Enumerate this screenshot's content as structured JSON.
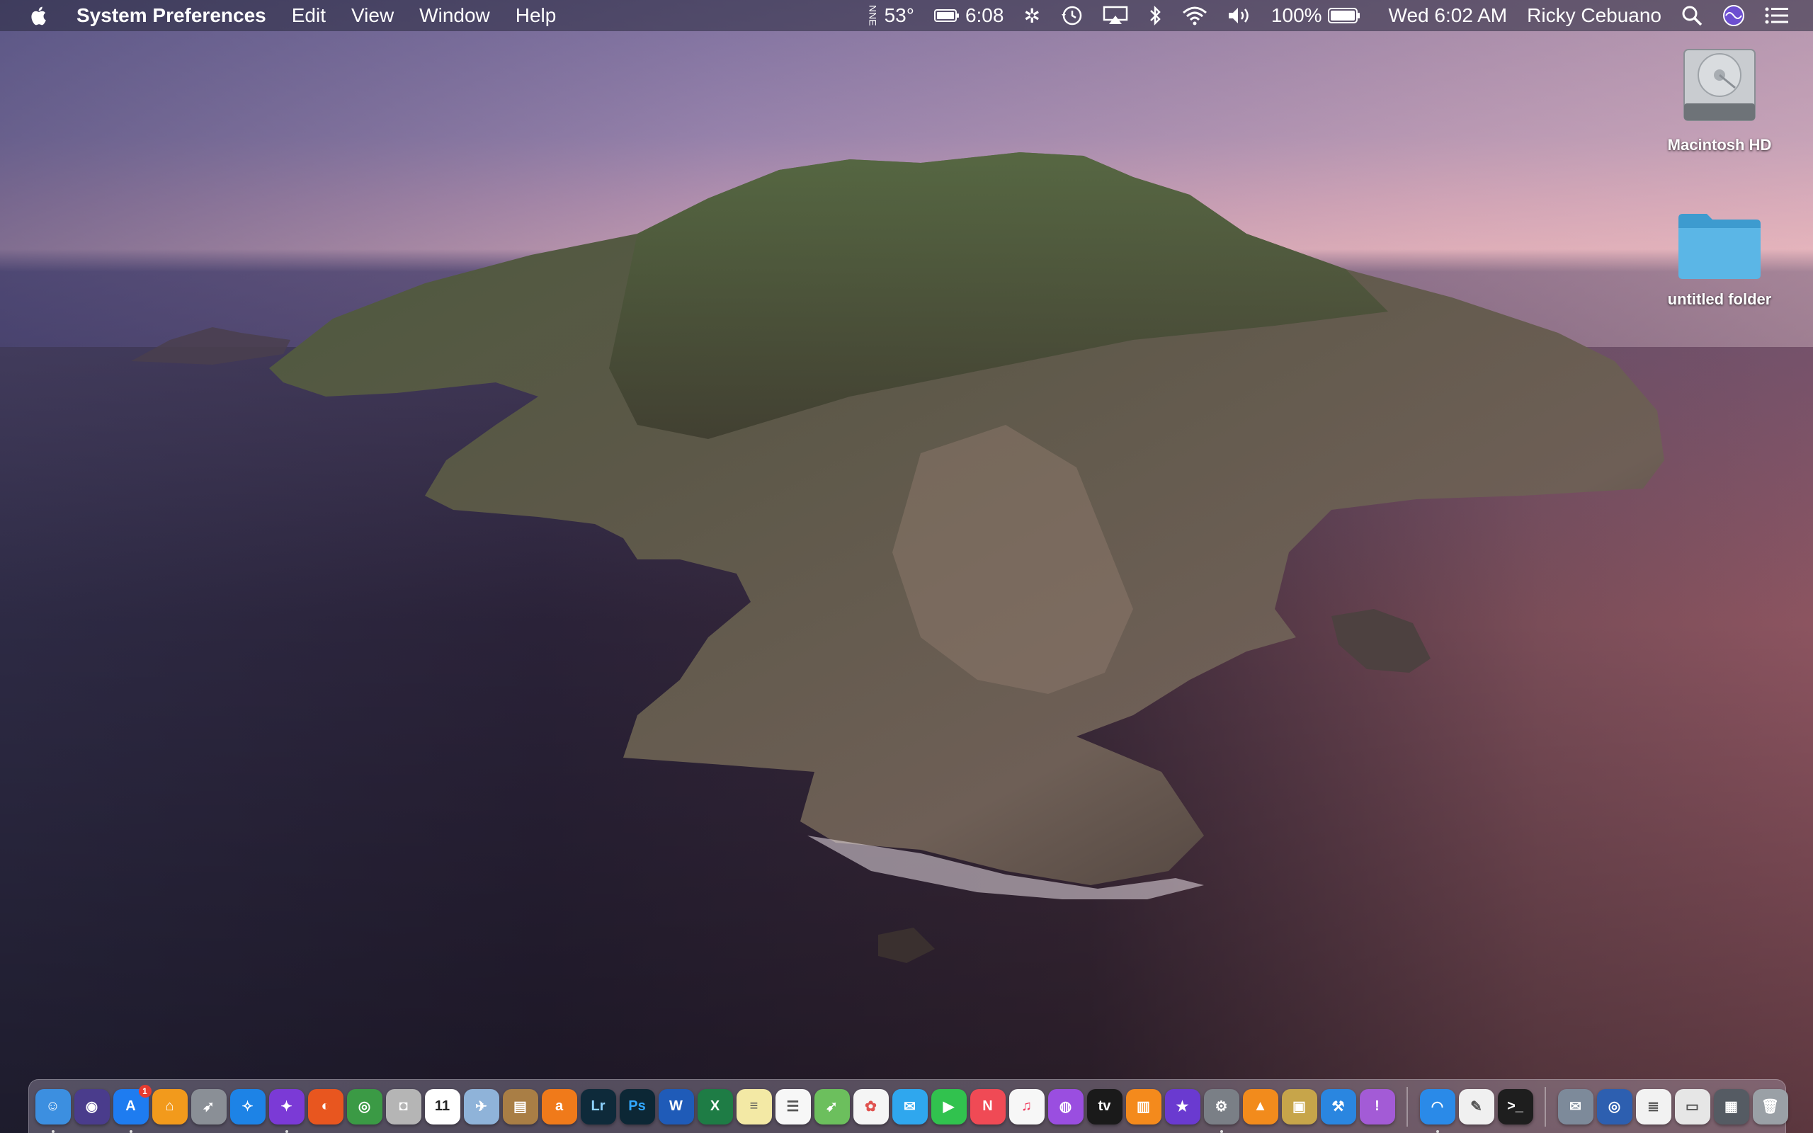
{
  "menubar": {
    "app_name": "System Preferences",
    "menus": [
      "Edit",
      "View",
      "Window",
      "Help"
    ],
    "status": {
      "weather": "53°",
      "battery_time": "6:08",
      "battery_percent": "100%",
      "datetime": "Wed 6:02 AM",
      "user": "Ricky Cebuano"
    }
  },
  "desktop": {
    "icons": [
      {
        "label": "Macintosh HD",
        "icon": "hard-drive-icon"
      },
      {
        "label": "untitled folder",
        "icon": "folder-icon"
      }
    ]
  },
  "dock": {
    "apps": [
      {
        "name": "Finder",
        "color": "#3c8fe0",
        "glyph": "☺",
        "running": true
      },
      {
        "name": "Siri",
        "color": "#4a3c8c",
        "glyph": "◉"
      },
      {
        "name": "App Store",
        "color": "#1e7cf0",
        "glyph": "A",
        "badge": "1",
        "running": true
      },
      {
        "name": "Home",
        "color": "#f29a1c",
        "glyph": "⌂"
      },
      {
        "name": "Launchpad",
        "color": "#8a8f96",
        "glyph": "➶"
      },
      {
        "name": "Safari",
        "color": "#1d83e6",
        "glyph": "✧"
      },
      {
        "name": "Compass",
        "color": "#7b3ad6",
        "glyph": "✦",
        "running": true
      },
      {
        "name": "Firefox",
        "color": "#e8561f",
        "glyph": "◐"
      },
      {
        "name": "Chrome",
        "color": "#3b9a45",
        "glyph": "◎"
      },
      {
        "name": "Screenshot",
        "color": "#b5b5b5",
        "glyph": "◘"
      },
      {
        "name": "Calendar",
        "color": "#ffffff",
        "glyph": "11",
        "text_color": "#222"
      },
      {
        "name": "Preview",
        "color": "#8fb3d9",
        "glyph": "✈"
      },
      {
        "name": "Archive Utility",
        "color": "#a97e45",
        "glyph": "▤"
      },
      {
        "name": "Avast",
        "color": "#f07a1a",
        "glyph": "a"
      },
      {
        "name": "Lightroom",
        "color": "#0e2a3a",
        "glyph": "Lr",
        "text_color": "#8fd3ff"
      },
      {
        "name": "Photoshop",
        "color": "#0c2735",
        "glyph": "Ps",
        "text_color": "#31a8ff"
      },
      {
        "name": "Word",
        "color": "#1f5bb8",
        "glyph": "W"
      },
      {
        "name": "Excel",
        "color": "#1e7c45",
        "glyph": "X"
      },
      {
        "name": "Notes",
        "color": "#f3e9a5",
        "glyph": "≡",
        "text_color": "#555"
      },
      {
        "name": "Reminders",
        "color": "#f7f7f7",
        "glyph": "☰",
        "text_color": "#555"
      },
      {
        "name": "Maps",
        "color": "#6cbf5d",
        "glyph": "➹"
      },
      {
        "name": "Photos",
        "color": "#f5f5f5",
        "glyph": "✿",
        "text_color": "#e0524f"
      },
      {
        "name": "Messages",
        "color": "#2fa7ee",
        "glyph": "✉"
      },
      {
        "name": "FaceTime",
        "color": "#31c24e",
        "glyph": "▶"
      },
      {
        "name": "News",
        "color": "#f04a55",
        "glyph": "N"
      },
      {
        "name": "Music",
        "color": "#f7f7f7",
        "glyph": "♫",
        "text_color": "#f0375a"
      },
      {
        "name": "Podcasts",
        "color": "#9a4ee0",
        "glyph": "◍"
      },
      {
        "name": "TV",
        "color": "#1a1a1a",
        "glyph": "tv"
      },
      {
        "name": "Books",
        "color": "#f48a1c",
        "glyph": "▥"
      },
      {
        "name": "iMovie",
        "color": "#6a3ad0",
        "glyph": "★"
      },
      {
        "name": "System Preferences",
        "color": "#7a7f86",
        "glyph": "⚙",
        "running": true
      },
      {
        "name": "VLC",
        "color": "#f28b1c",
        "glyph": "▲"
      },
      {
        "name": "Preview Image",
        "color": "#c7a54a",
        "glyph": "▣"
      },
      {
        "name": "Xcode",
        "color": "#2a86e0",
        "glyph": "⚒"
      },
      {
        "name": "Feedback Assistant",
        "color": "#a35bd6",
        "glyph": "!"
      },
      {
        "name": "Wireless Diagnostics",
        "color": "#2a8ae8",
        "glyph": "◠",
        "running": true
      },
      {
        "name": "TextEdit",
        "color": "#f0f0f0",
        "glyph": "✎",
        "text_color": "#555"
      },
      {
        "name": "Terminal",
        "color": "#1e1e1e",
        "glyph": ">_"
      },
      {
        "name": "Mail Bird",
        "color": "#7d8a9a",
        "glyph": "✉"
      },
      {
        "name": "Network Radar",
        "color": "#2d5fb0",
        "glyph": "◎"
      },
      {
        "name": "Document 1",
        "color": "#f2f2f2",
        "glyph": "≣",
        "text_color": "#555"
      },
      {
        "name": "Document 2",
        "color": "#e6e6e6",
        "glyph": "▭",
        "text_color": "#555"
      },
      {
        "name": "Screen Capture",
        "color": "#555b63",
        "glyph": "▦"
      },
      {
        "name": "Trash",
        "color": "#9aa0a6",
        "glyph": "🗑"
      }
    ]
  }
}
